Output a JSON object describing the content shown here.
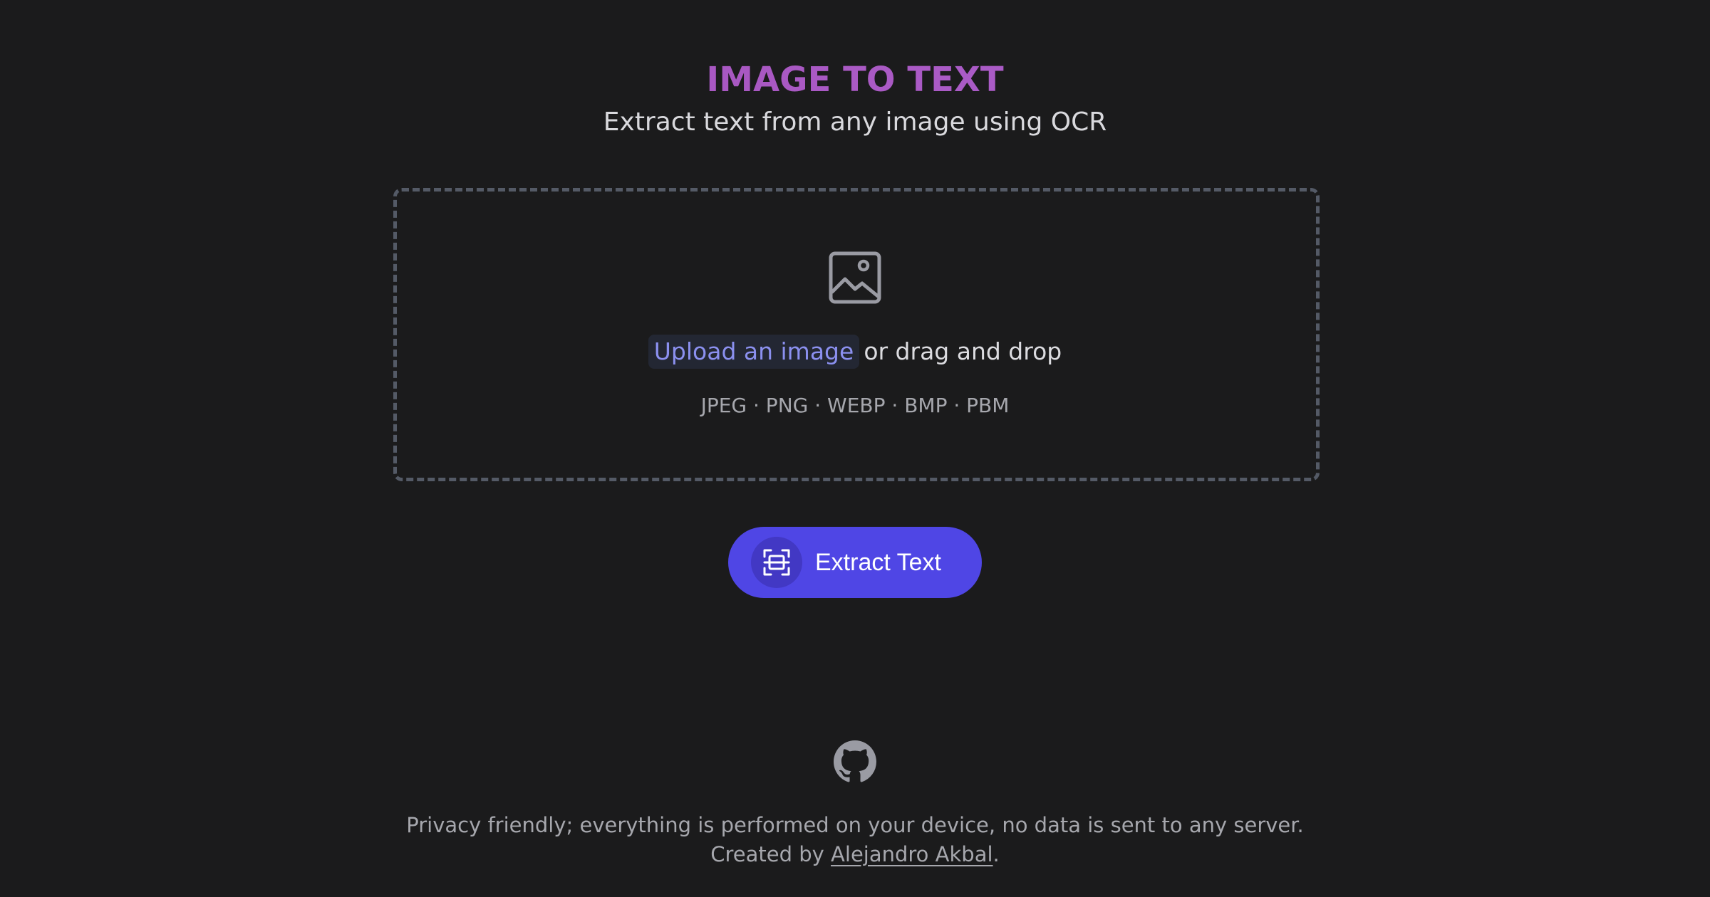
{
  "header": {
    "title": "IMAGE TO TEXT",
    "subtitle": "Extract text from any image using OCR"
  },
  "dropzone": {
    "icon": "image-icon",
    "upload_label": "Upload an image",
    "drag_text": "or drag and drop",
    "formats": "JPEG · PNG · WEBP · BMP · PBM"
  },
  "extract_button": {
    "icon": "scan-text-icon",
    "label": "Extract Text"
  },
  "footer": {
    "icon": "github-icon",
    "privacy_text": "Privacy friendly; everything is performed on your device, no data is sent to any server.",
    "created_by_prefix": "Created by",
    "author_name": "Alejandro Akbal",
    "suffix": "."
  },
  "colors": {
    "background": "#1b1b1c",
    "title": "#a855c4",
    "accent": "#4f46e5",
    "link": "#8b90ef"
  }
}
